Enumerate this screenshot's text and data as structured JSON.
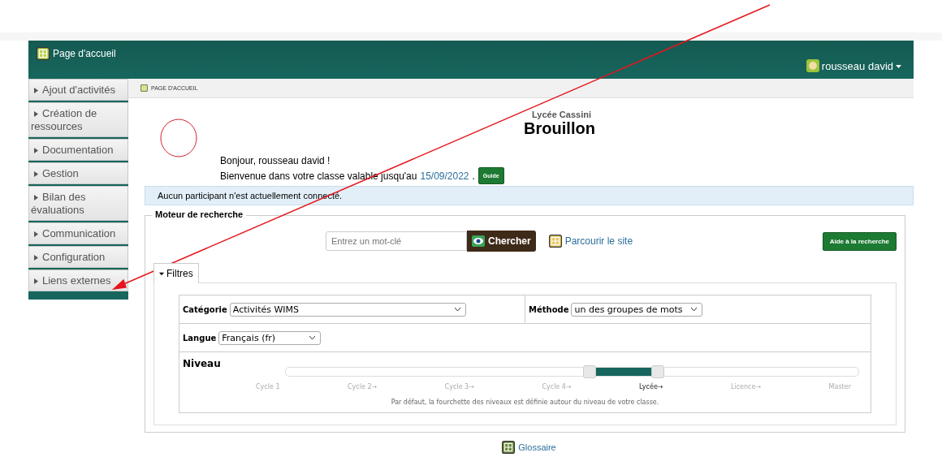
{
  "header": {
    "home": "Page d'accueil",
    "user": "rousseau david"
  },
  "sidebar": {
    "items": [
      "Ajout d'activités",
      "Création de ressources",
      "Documentation",
      "Gestion",
      "Bilan des évaluations",
      "Communication",
      "Configuration",
      "Liens externes"
    ]
  },
  "breadcrumb": "PAGE D'ACCUEIL",
  "school": "Lycée Cassini",
  "class_title": "Brouillon",
  "greeting": "Bonjour, rousseau david !",
  "welcome": {
    "text": "Bienvenue dans votre classe valable jusqu'au",
    "date": "15/09/2022",
    "after": ".",
    "button": "Guide"
  },
  "notice": "Aucun participant n'est actuellement connecté.",
  "search": {
    "legend": "Moteur de recherche",
    "placeholder": "Entrez un mot-clé",
    "button": "Chercher",
    "browse": "Parcourir le site",
    "help": "Aide à la recherche",
    "filters_tab": "Filtres",
    "filters_expanded": true,
    "category": {
      "label": "Catégorie",
      "value": "Activités WIMS"
    },
    "method": {
      "label": "Méthode",
      "value": "un des groupes de mots"
    },
    "language": {
      "label": "Langue",
      "value": "Français (fr)"
    },
    "level": {
      "label": "Niveau",
      "thumbs": [
        {
          "level": 0.53
        },
        {
          "level": 0.65
        }
      ],
      "ticks": [
        {
          "label": "Cycle 1",
          "selected": false
        },
        {
          "label": "Cycle 2→",
          "selected": false
        },
        {
          "label": "Cycle 3→",
          "selected": false
        },
        {
          "label": "Cycle 4→",
          "selected": false
        },
        {
          "label": "Lycée→",
          "selected": true
        },
        {
          "label": "Licence→",
          "selected": false
        },
        {
          "label": "Master",
          "selected": false
        }
      ],
      "note": "Par défaut, la fourchette des niveaux est définie autour du niveau de votre classe."
    }
  },
  "glossary": "Glossaire"
}
